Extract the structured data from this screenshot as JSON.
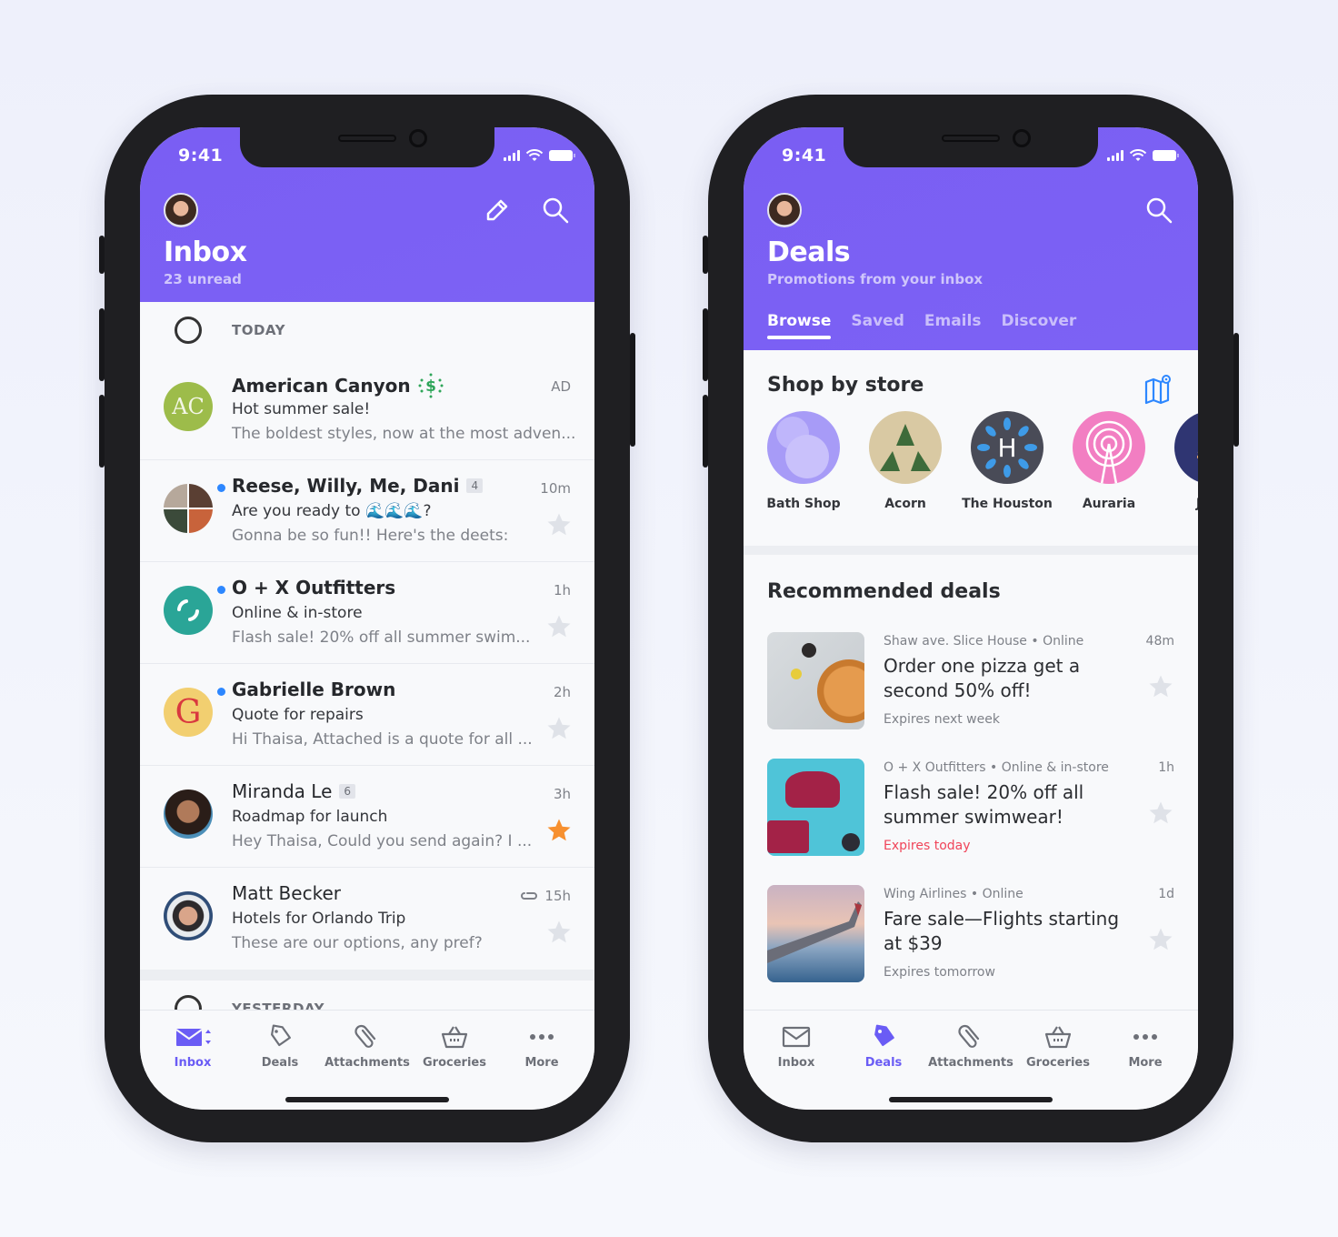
{
  "colors": {
    "brand_purple": "#7b5ff2",
    "active_tab": "#6a5cf5",
    "unread_dot": "#2d87ff",
    "starred": "#f7902f",
    "expires_urgent": "#f0455a",
    "map_icon": "#2d87ff"
  },
  "status_bar": {
    "time": "9:41"
  },
  "inbox_screen": {
    "header": {
      "title": "Inbox",
      "subtitle": "23 unread",
      "actions": [
        "compose-icon",
        "search-icon"
      ]
    },
    "sections": [
      {
        "label": "TODAY"
      },
      {
        "label": "YESTERDAY"
      }
    ],
    "messages": [
      {
        "sender": "American Canyon",
        "sender_badge": "dollar-sparkle-icon",
        "avatar_initials": "AC",
        "subject": "Hot summer sale!",
        "snippet": "The boldest styles, now at the most adven...",
        "meta": "AD",
        "unread": false,
        "bold": true,
        "starred": null
      },
      {
        "sender": "Reese, Willy, Me, Dani",
        "thread_count": "4",
        "subject": "Are you ready to 🌊🌊🌊?",
        "snippet": "Gonna be so fun!! Here's the deets:",
        "meta": "10m",
        "unread": true,
        "bold": true,
        "starred": false
      },
      {
        "sender": "O + X Outfitters",
        "subject": "Online & in-store",
        "snippet": "Flash sale! 20% off all summer swim...",
        "meta": "1h",
        "unread": true,
        "bold": true,
        "starred": false
      },
      {
        "sender": "Gabrielle Brown",
        "avatar_initials": "G",
        "subject": "Quote for repairs",
        "snippet": "Hi Thaisa, Attached is a quote for all ...",
        "meta": "2h",
        "unread": true,
        "bold": true,
        "starred": false
      },
      {
        "sender": "Miranda Le",
        "thread_count": "6",
        "subject": "Roadmap for launch",
        "snippet": "Hey Thaisa, Could you send again? I ...",
        "meta": "3h",
        "unread": false,
        "bold": false,
        "starred": true
      },
      {
        "sender": "Matt Becker",
        "subject": "Hotels for Orlando Trip",
        "snippet": "These are our options, any pref?",
        "meta": "15h",
        "has_attachment": true,
        "unread": false,
        "bold": false,
        "starred": false
      }
    ],
    "tabbar": [
      {
        "label": "Inbox",
        "icon": "mail-icon",
        "active": true
      },
      {
        "label": "Deals",
        "icon": "tag-icon",
        "active": false
      },
      {
        "label": "Attachments",
        "icon": "paperclip-icon",
        "active": false
      },
      {
        "label": "Groceries",
        "icon": "basket-icon",
        "active": false
      },
      {
        "label": "More",
        "icon": "more-icon",
        "active": false
      }
    ]
  },
  "deals_screen": {
    "header": {
      "title": "Deals",
      "subtitle": "Promotions from your inbox",
      "actions": [
        "search-icon"
      ]
    },
    "tabs": [
      {
        "label": "Browse",
        "active": true
      },
      {
        "label": "Saved",
        "active": false
      },
      {
        "label": "Emails",
        "active": false
      },
      {
        "label": "Discover",
        "active": false
      }
    ],
    "shop_by_store": {
      "title": "Shop by store",
      "stores": [
        {
          "name": "Bath Shop"
        },
        {
          "name": "Acorn"
        },
        {
          "name": "The Houston"
        },
        {
          "name": "Auraria"
        },
        {
          "name": "Jack"
        }
      ]
    },
    "recommended": {
      "title": "Recommended deals",
      "deals": [
        {
          "store": "Shaw ave. Slice House • Online",
          "headline": "Order one pizza get a second 50% off!",
          "expires": "Expires next week",
          "urgent": false,
          "age": "48m",
          "image": "pizza"
        },
        {
          "store": "O + X Outfitters • Online & in-store",
          "headline": "Flash sale! 20% off all summer swimwear!",
          "expires": "Expires today",
          "urgent": true,
          "age": "1h",
          "image": "swimwear"
        },
        {
          "store": "Wing Airlines • Online",
          "headline": "Fare sale—Flights starting at $39",
          "expires": "Expires tomorrow",
          "urgent": false,
          "age": "1d",
          "image": "airplane-wing"
        }
      ]
    },
    "tabbar": [
      {
        "label": "Inbox",
        "icon": "mail-icon",
        "active": false
      },
      {
        "label": "Deals",
        "icon": "tag-icon",
        "active": true
      },
      {
        "label": "Attachments",
        "icon": "paperclip-icon",
        "active": false
      },
      {
        "label": "Groceries",
        "icon": "basket-icon",
        "active": false
      },
      {
        "label": "More",
        "icon": "more-icon",
        "active": false
      }
    ]
  }
}
